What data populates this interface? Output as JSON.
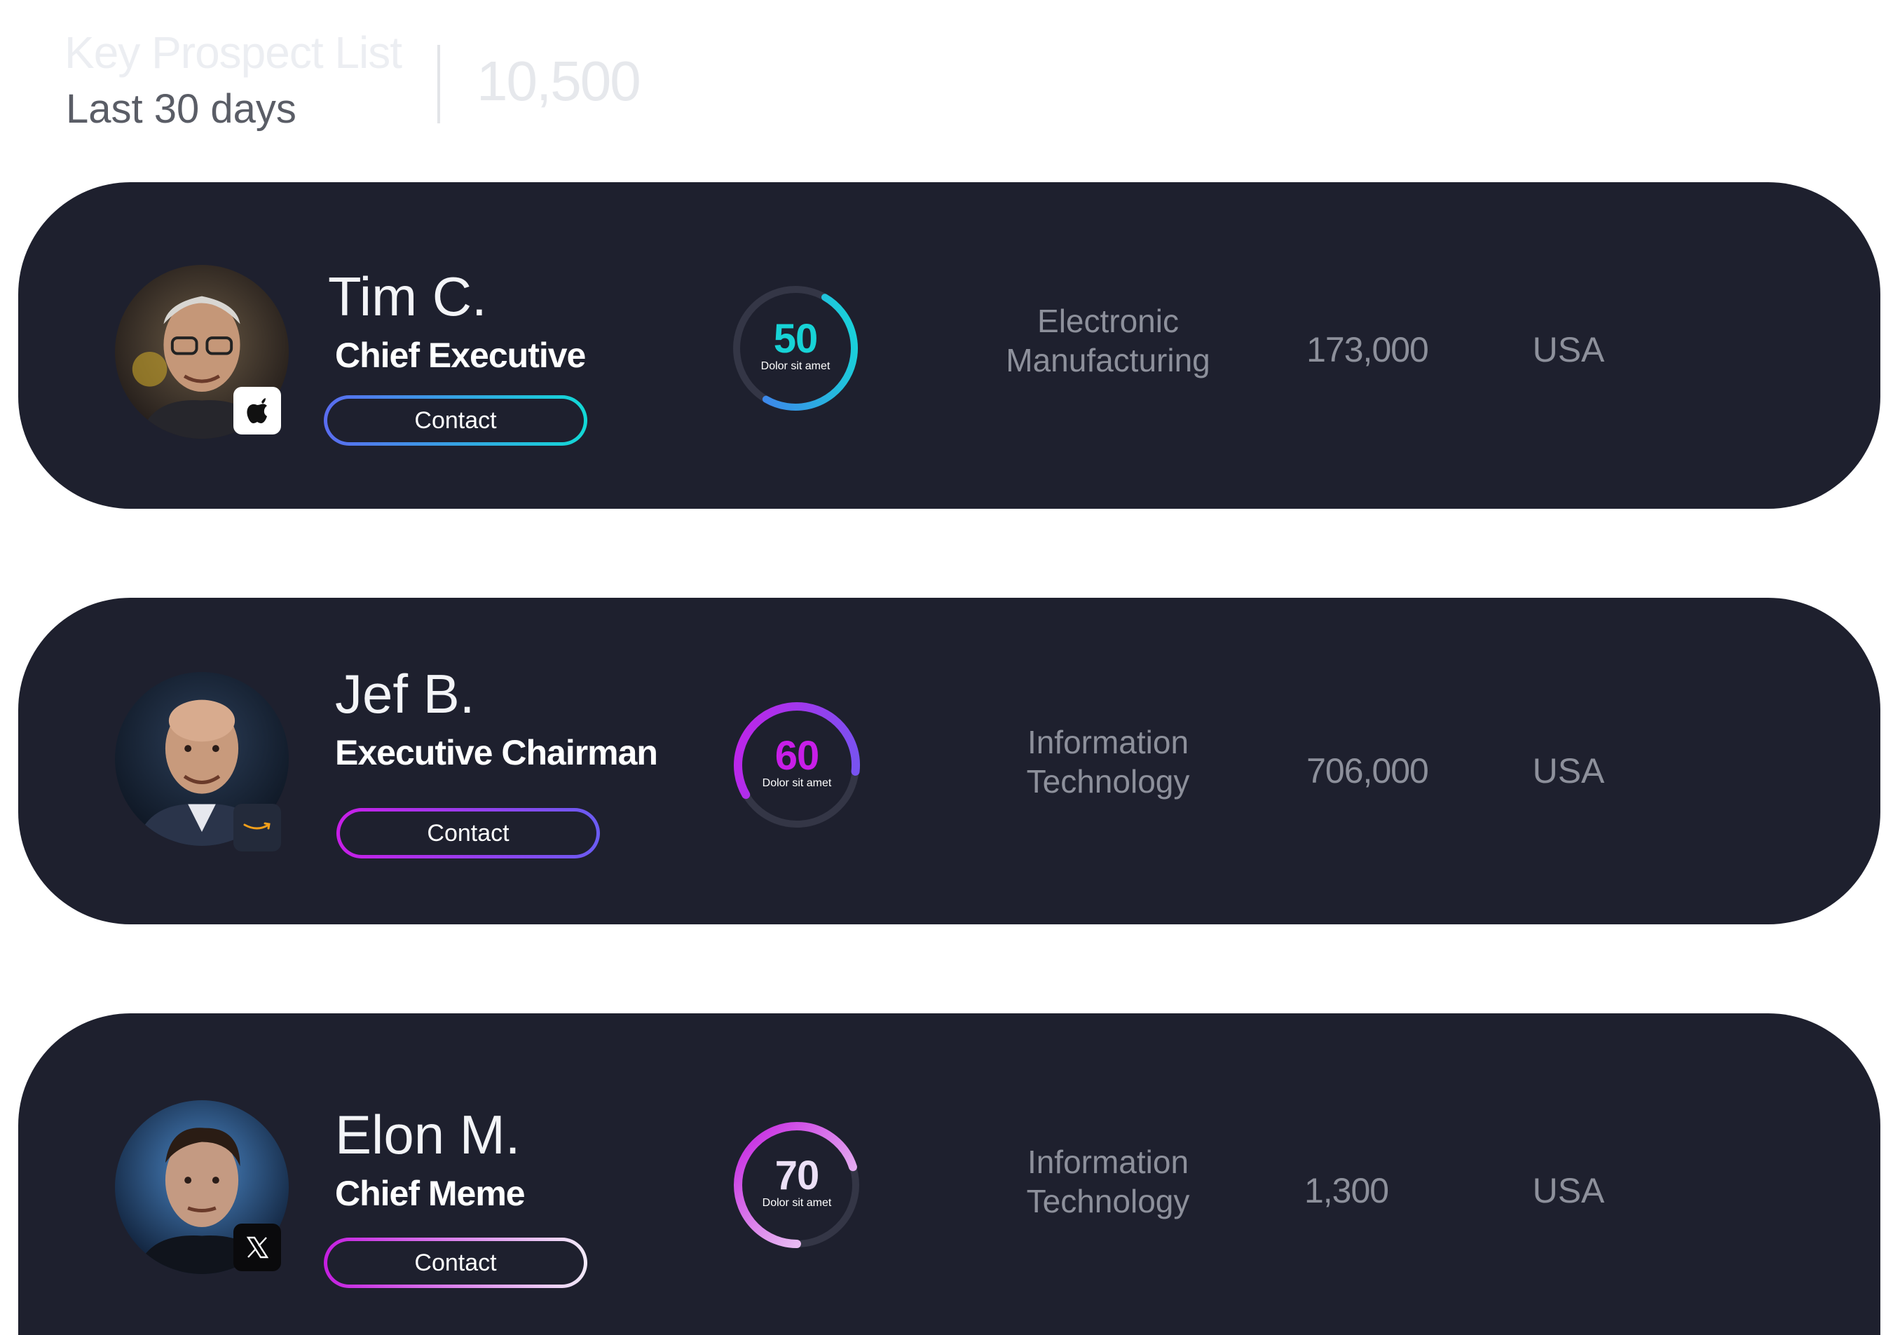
{
  "header": {
    "title": "Key Prospect List",
    "subtitle": "Last 30 days",
    "total": "10,500"
  },
  "prospects": [
    {
      "name": "Tim C.",
      "title": "Chief Executive",
      "contact_label": "Contact",
      "brand": "apple-logo-icon",
      "score": "50",
      "score_fraction": 0.5,
      "score_label": "Dolor sit amet",
      "score_color": "#17d3d6",
      "industry_line1": "Electronic",
      "industry_line2": "Manufacturing",
      "employees": "173,000",
      "country": "USA",
      "gradient": [
        "#5a6cf0",
        "#12d9d6"
      ]
    },
    {
      "name": "Jef B.",
      "title": "Executive Chairman",
      "contact_label": "Contact",
      "brand": "amazon-logo-icon",
      "score": "60",
      "score_fraction": 0.6,
      "score_label": "Dolor sit amet",
      "score_color": "#c81ee8",
      "industry_line1": "Information",
      "industry_line2": "Technology",
      "employees": "706,000",
      "country": "USA",
      "gradient": [
        "#c81ee8",
        "#6a5cf2"
      ]
    },
    {
      "name": "Elon M.",
      "title": "Chief Meme",
      "contact_label": "Contact",
      "brand": "x-logo-icon",
      "score": "70",
      "score_fraction": 0.7,
      "score_label": "Dolor sit amet",
      "score_color": "#e9d8f5",
      "industry_line1": "Information",
      "industry_line2": "Technology",
      "employees": "1,300",
      "country": "USA",
      "gradient": [
        "#c41ee0",
        "#f2eaf8"
      ]
    }
  ]
}
